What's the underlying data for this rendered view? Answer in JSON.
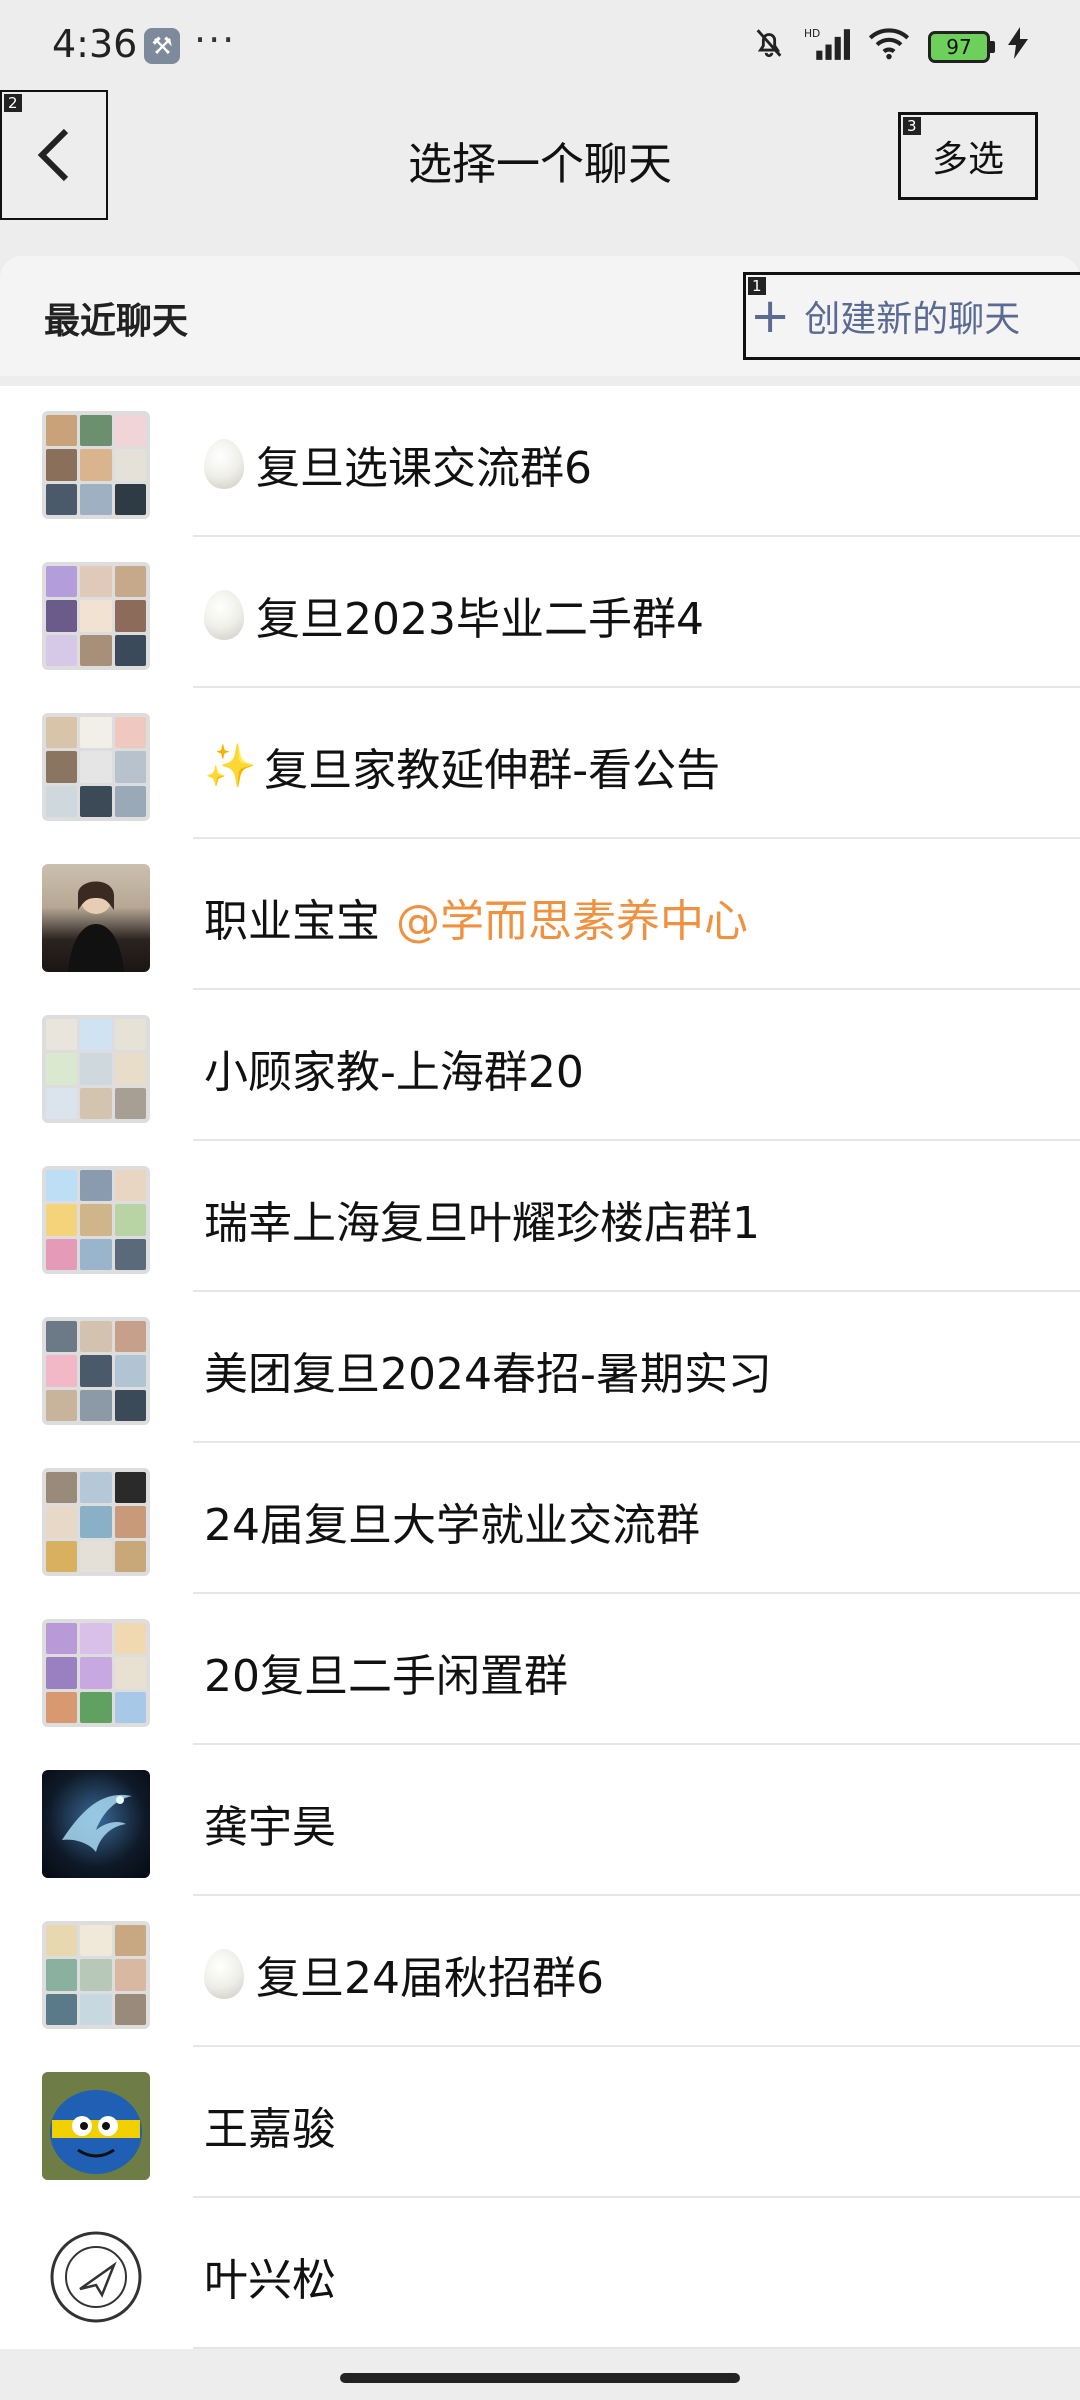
{
  "status_bar": {
    "time": "4:36",
    "tool_icon": "wrench-icon",
    "more": "···",
    "icons": [
      "bell-muted-icon",
      "hd-signal-icon",
      "wifi-icon",
      "battery-icon",
      "charging-icon"
    ],
    "battery_level": "97"
  },
  "header": {
    "back_tag": "2",
    "title": "选择一个聊天",
    "multi_tag": "3",
    "multi_label": "多选"
  },
  "section": {
    "title": "最近聊天",
    "create_tag": "1",
    "create_plus": "+",
    "create_label": "创建新的聊天"
  },
  "colors": {
    "background": "#ededed",
    "link": "#5b6a92",
    "mention": "#f0913f"
  },
  "chats": [
    {
      "prefix": "egg",
      "name": "复旦选课交流群6",
      "avatar": "grid"
    },
    {
      "prefix": "egg",
      "name": "复旦2023毕业二手群4",
      "avatar": "grid"
    },
    {
      "prefix": "sparkle",
      "name": "复旦家教延伸群-看公告",
      "avatar": "grid"
    },
    {
      "prefix": "",
      "name": "职业宝宝",
      "mention": "@学而思素养中心",
      "avatar": "photo"
    },
    {
      "prefix": "",
      "name": "小顾家教-上海群20",
      "avatar": "grid"
    },
    {
      "prefix": "",
      "name": "瑞幸上海复旦叶耀珍楼店群1",
      "avatar": "grid"
    },
    {
      "prefix": "",
      "name": "美团复旦2024春招-暑期实习",
      "avatar": "grid"
    },
    {
      "prefix": "",
      "name": "24届复旦大学就业交流群",
      "avatar": "grid"
    },
    {
      "prefix": "",
      "name": "20复旦二手闲置群",
      "avatar": "grid"
    },
    {
      "prefix": "",
      "name": "龚宇昊",
      "avatar": "dragon"
    },
    {
      "prefix": "egg",
      "name": "复旦24届秋招群6",
      "avatar": "grid"
    },
    {
      "prefix": "",
      "name": "王嘉骏",
      "avatar": "cartoon"
    },
    {
      "prefix": "",
      "name": "叶兴松",
      "avatar": "seal"
    }
  ]
}
